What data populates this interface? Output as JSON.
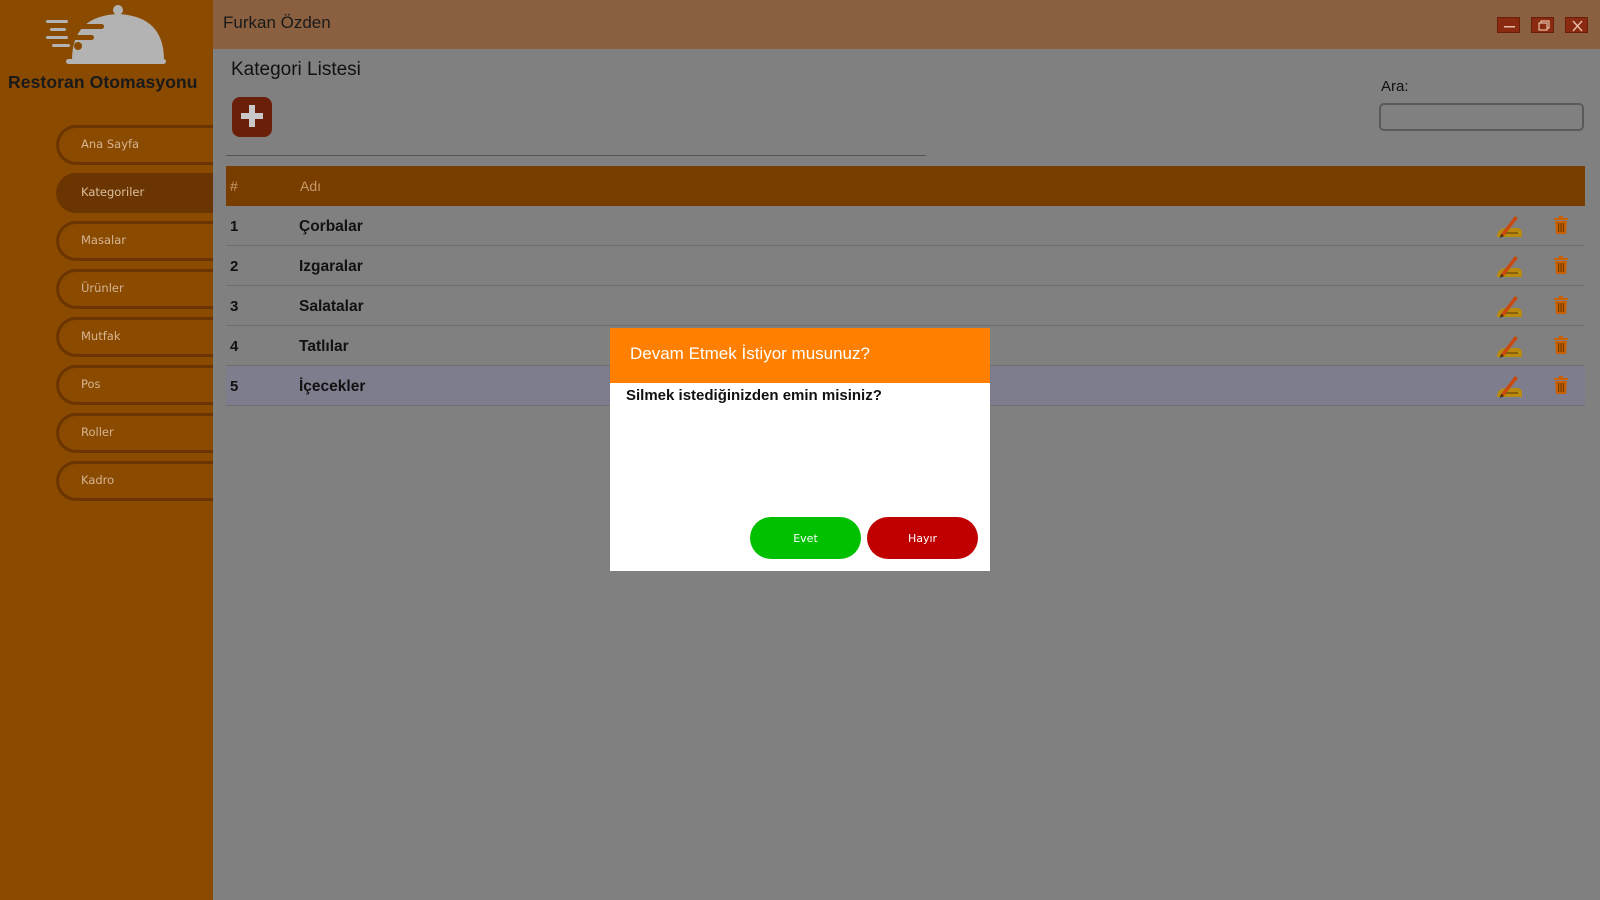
{
  "app": {
    "brand": "Restoran Otomasyonu",
    "user_name": "Furkan Özden"
  },
  "sidebar": {
    "items": [
      {
        "label": "Ana Sayfa"
      },
      {
        "label": "Kategoriler"
      },
      {
        "label": "Masalar"
      },
      {
        "label": "Ürünler"
      },
      {
        "label": "Mutfak"
      },
      {
        "label": "Pos"
      },
      {
        "label": "Roller"
      },
      {
        "label": "Kadro"
      }
    ],
    "active": "Kategoriler"
  },
  "page": {
    "title": "Kategori Listesi",
    "search_label": "Ara:",
    "search_value": ""
  },
  "table": {
    "headers": [
      "#",
      "Adı"
    ],
    "rows": [
      {
        "num": "1",
        "name": "Çorbalar"
      },
      {
        "num": "2",
        "name": "Izgaralar"
      },
      {
        "num": "3",
        "name": "Salatalar"
      },
      {
        "num": "4",
        "name": "Tatlılar"
      },
      {
        "num": "5",
        "name": "İçecekler"
      }
    ],
    "selected_row": "5"
  },
  "dialog": {
    "title": "Devam Etmek İstiyor musunuz?",
    "message": "Silmek istediğinizden emin misiniz?",
    "yes_label": "Evet",
    "no_label": "Hayır"
  },
  "icons": {
    "logo": "cloche-icon",
    "add": "plus-icon",
    "edit": "pencil-hand-icon",
    "delete": "trash-icon",
    "minimize": "minimize-icon",
    "maximize": "restore-icon",
    "close": "close-icon"
  },
  "colors": {
    "sidebar": "#8a4a00",
    "header": "#7a3d00",
    "dialog_header": "#ff8000",
    "yes": "#00c000",
    "no": "#c00000"
  }
}
